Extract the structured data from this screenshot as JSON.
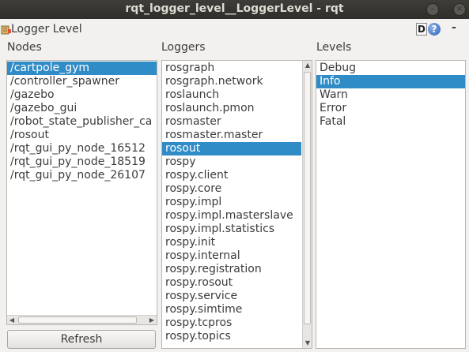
{
  "window": {
    "title": "rqt_logger_level__LoggerLevel - rqt"
  },
  "plugin": {
    "title": "Logger Level",
    "d_label": "D",
    "help_label": "?",
    "dash_label": "-"
  },
  "nodes": {
    "label": "Nodes",
    "items": [
      "/cartpole_gym",
      "/controller_spawner",
      "/gazebo",
      "/gazebo_gui",
      "/robot_state_publisher_ca",
      "/rosout",
      "/rqt_gui_py_node_16512",
      "/rqt_gui_py_node_18519",
      "/rqt_gui_py_node_26107"
    ],
    "selected": 0,
    "refresh_label": "Refresh"
  },
  "loggers": {
    "label": "Loggers",
    "items": [
      "rosgraph",
      "rosgraph.network",
      "roslaunch",
      "roslaunch.pmon",
      "rosmaster",
      "rosmaster.master",
      "rosout",
      "rospy",
      "rospy.client",
      "rospy.core",
      "rospy.impl",
      "rospy.impl.masterslave",
      "rospy.impl.statistics",
      "rospy.init",
      "rospy.internal",
      "rospy.registration",
      "rospy.rosout",
      "rospy.service",
      "rospy.simtime",
      "rospy.tcpros",
      "rospy.topics"
    ],
    "selected": 6
  },
  "levels": {
    "label": "Levels",
    "items": [
      "Debug",
      "Info",
      "Warn",
      "Error",
      "Fatal"
    ],
    "selected": 1
  },
  "colors": {
    "selection": "#308cc6",
    "titlebar": "#3e3d39"
  }
}
